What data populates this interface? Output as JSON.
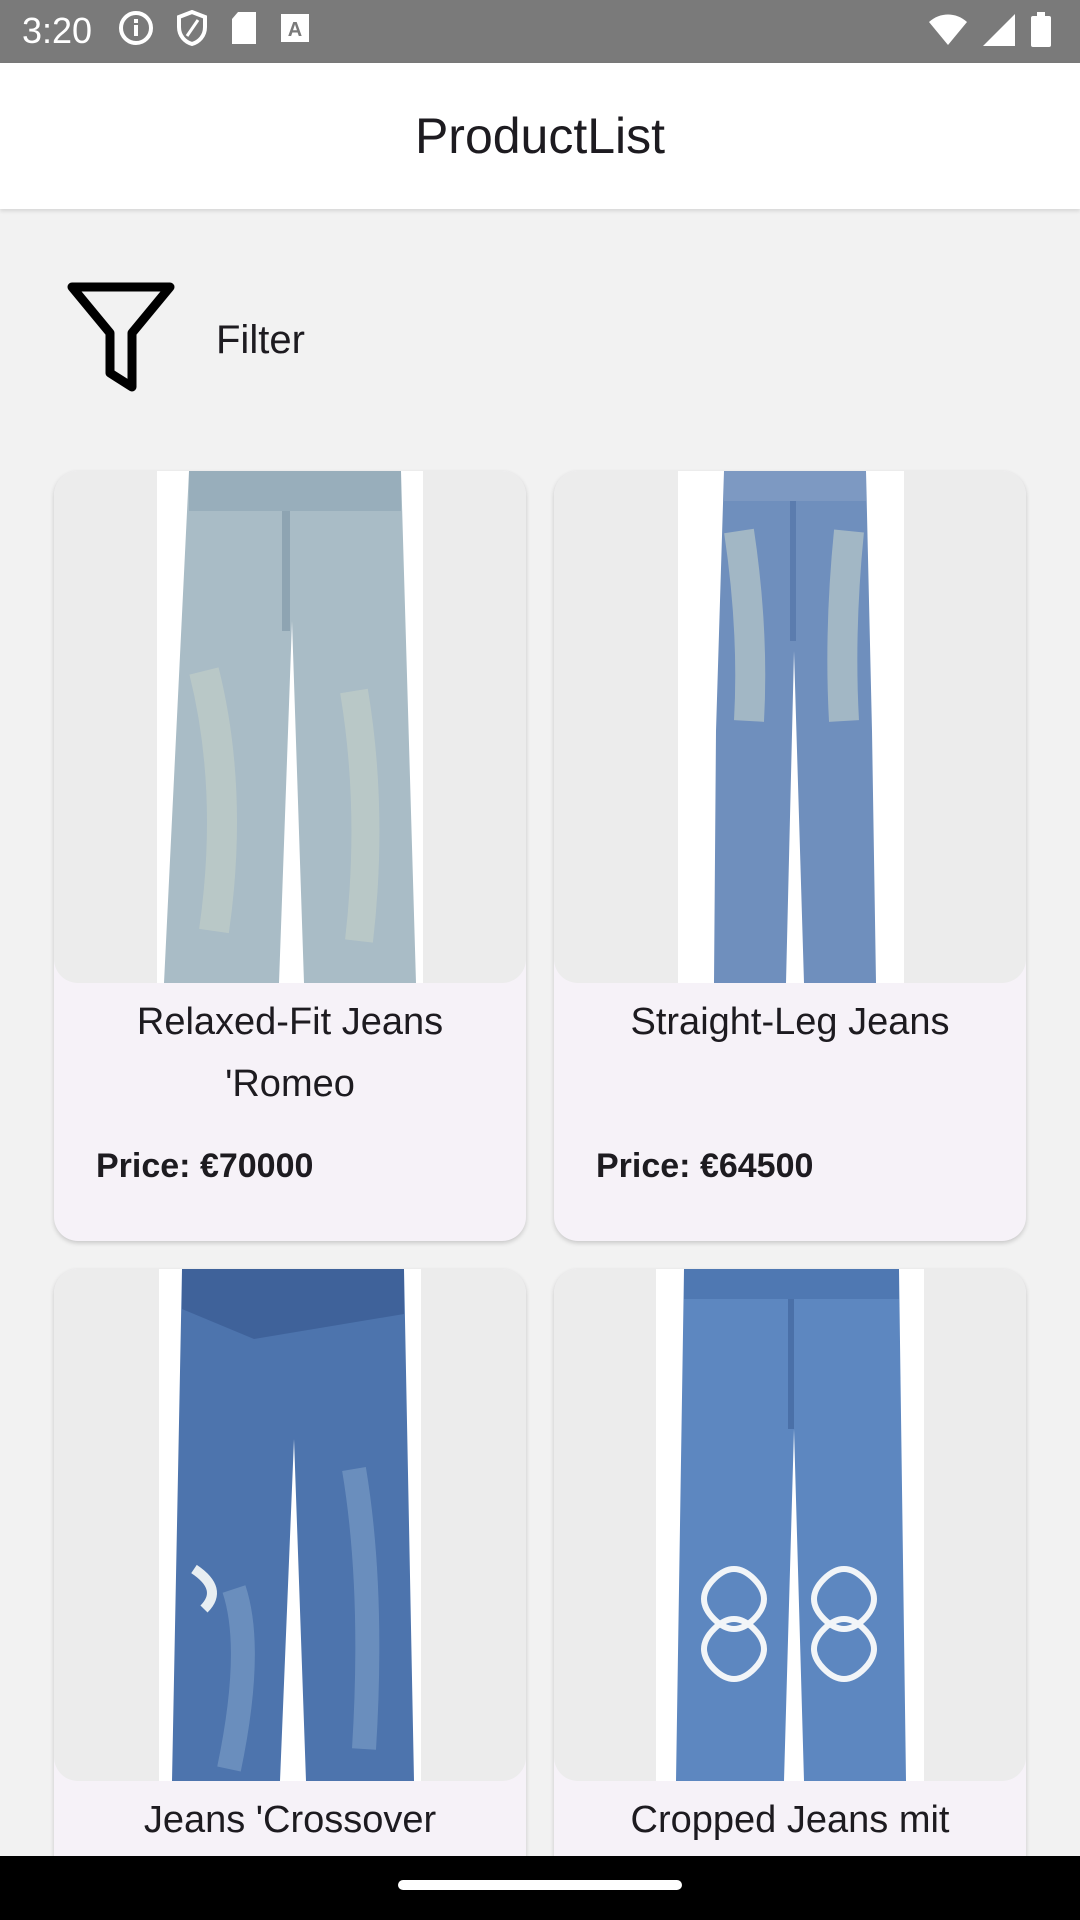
{
  "status_bar": {
    "time": "3:20",
    "left_icons": [
      "info-icon",
      "shield-icon",
      "sd-card-icon",
      "text-a-icon"
    ],
    "right_icons": [
      "wifi-icon",
      "signal-icon",
      "battery-icon"
    ]
  },
  "app_bar": {
    "title": "ProductList"
  },
  "filter": {
    "label": "Filter",
    "icon": "filter-icon"
  },
  "products": [
    {
      "title": "Relaxed-Fit Jeans 'Romeo",
      "price": "Price: €70000",
      "denim_color": "#a9bcc6"
    },
    {
      "title": "Straight-Leg Jeans",
      "price": "Price: €64500",
      "denim_color": "#6f8fbd"
    },
    {
      "title": "Jeans 'Crossover",
      "price": "",
      "denim_color": "#4d74ad"
    },
    {
      "title": "Cropped Jeans mit",
      "price": "",
      "denim_color": "#5d87c0"
    }
  ],
  "colors": {
    "status_bar": "#7a7a7a",
    "app_bar": "#ffffff",
    "background": "#f2f2f2",
    "card": "#f6f2f8",
    "nav_bar": "#000000"
  }
}
